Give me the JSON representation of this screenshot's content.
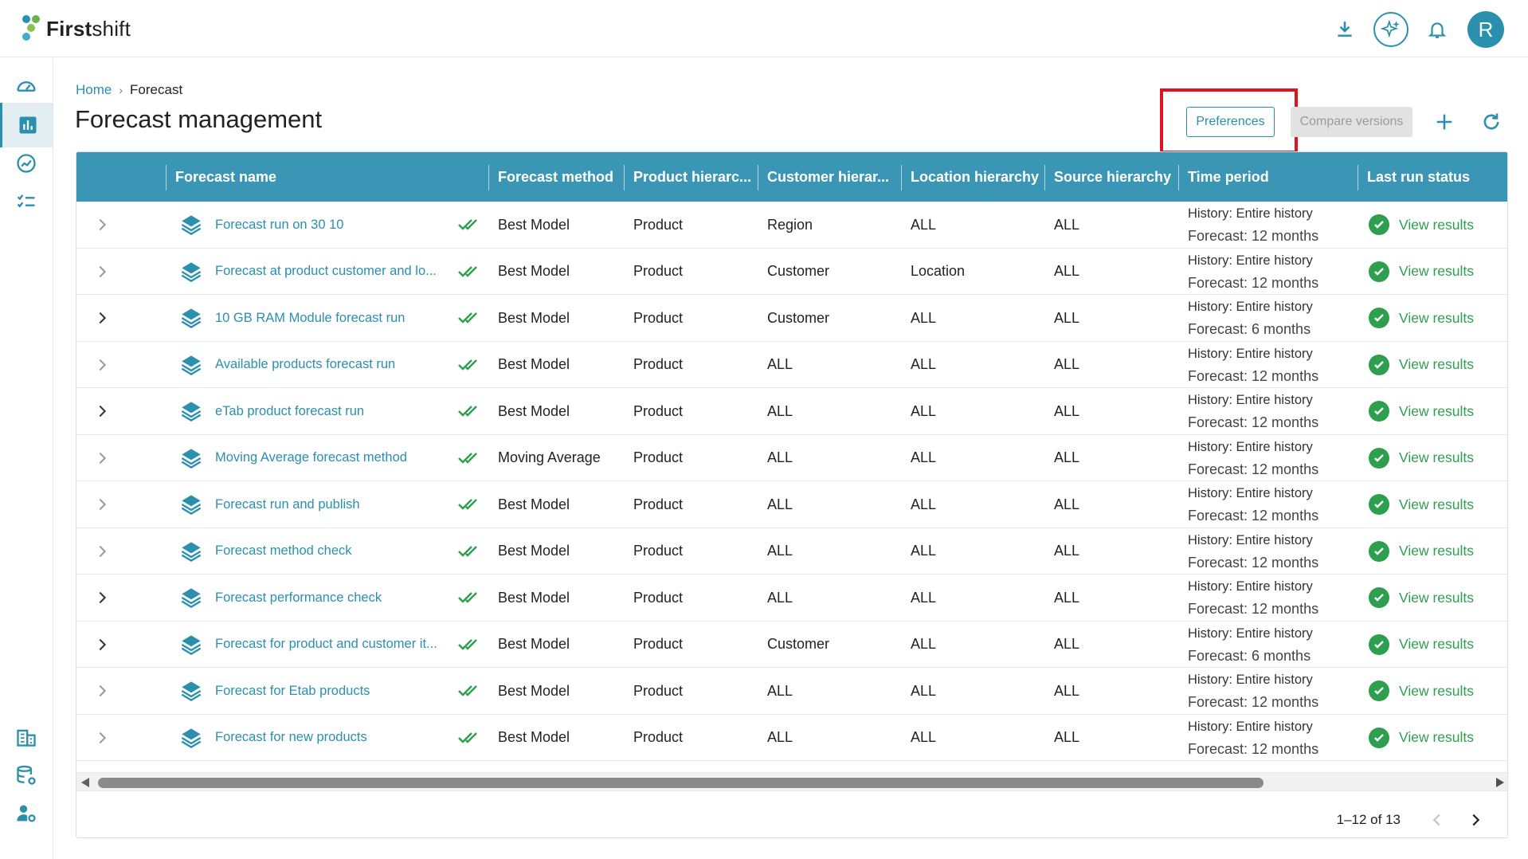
{
  "app": {
    "brand_bold": "First",
    "brand_light": "shift",
    "user_initial": "R"
  },
  "breadcrumb": {
    "home": "Home",
    "separator": "›",
    "current": "Forecast"
  },
  "page_title": "Forecast management",
  "actions": {
    "preferences_label": "Preferences",
    "compare_label": "Compare versions"
  },
  "table": {
    "columns": [
      "Forecast name",
      "Forecast method",
      "Product hierarc...",
      "Customer hierar...",
      "Location hierarchy",
      "Source hierarchy",
      "Time period",
      "Last run status"
    ],
    "rows": [
      {
        "name": "Forecast run on 30 10",
        "method": "Best Model",
        "product": "Product",
        "customer": "Region",
        "location": "ALL",
        "source": "ALL",
        "history": "History: Entire history",
        "forecast": "Forecast: 12 months",
        "status": "View results"
      },
      {
        "name": "Forecast at product customer and lo...",
        "method": "Best Model",
        "product": "Product",
        "customer": "Customer",
        "location": "Location",
        "source": "ALL",
        "history": "History: Entire history",
        "forecast": "Forecast: 12 months",
        "status": "View results"
      },
      {
        "name": "10 GB RAM Module forecast run",
        "method": "Best Model",
        "product": "Product",
        "customer": "Customer",
        "location": "ALL",
        "source": "ALL",
        "history": "History: Entire history",
        "forecast": "Forecast: 6 months",
        "status": "View results"
      },
      {
        "name": "Available products forecast run",
        "method": "Best Model",
        "product": "Product",
        "customer": "ALL",
        "location": "ALL",
        "source": "ALL",
        "history": "History: Entire history",
        "forecast": "Forecast: 12 months",
        "status": "View results"
      },
      {
        "name": "eTab product forecast run",
        "method": "Best Model",
        "product": "Product",
        "customer": "ALL",
        "location": "ALL",
        "source": "ALL",
        "history": "History: Entire history",
        "forecast": "Forecast: 12 months",
        "status": "View results"
      },
      {
        "name": "Moving Average forecast method",
        "method": "Moving Average",
        "product": "Product",
        "customer": "ALL",
        "location": "ALL",
        "source": "ALL",
        "history": "History: Entire history",
        "forecast": "Forecast: 12 months",
        "status": "View results"
      },
      {
        "name": "Forecast run and publish",
        "method": "Best Model",
        "product": "Product",
        "customer": "ALL",
        "location": "ALL",
        "source": "ALL",
        "history": "History: Entire history",
        "forecast": "Forecast: 12 months",
        "status": "View results"
      },
      {
        "name": "Forecast method check",
        "method": "Best Model",
        "product": "Product",
        "customer": "ALL",
        "location": "ALL",
        "source": "ALL",
        "history": "History: Entire history",
        "forecast": "Forecast: 12 months",
        "status": "View results"
      },
      {
        "name": "Forecast performance check",
        "method": "Best Model",
        "product": "Product",
        "customer": "ALL",
        "location": "ALL",
        "source": "ALL",
        "history": "History: Entire history",
        "forecast": "Forecast: 12 months",
        "status": "View results"
      },
      {
        "name": "Forecast for product and customer it...",
        "method": "Best Model",
        "product": "Product",
        "customer": "Customer",
        "location": "ALL",
        "source": "ALL",
        "history": "History: Entire history",
        "forecast": "Forecast: 6 months",
        "status": "View results"
      },
      {
        "name": "Forecast for Etab products",
        "method": "Best Model",
        "product": "Product",
        "customer": "ALL",
        "location": "ALL",
        "source": "ALL",
        "history": "History: Entire history",
        "forecast": "Forecast: 12 months",
        "status": "View results"
      },
      {
        "name": "Forecast for new products",
        "method": "Best Model",
        "product": "Product",
        "customer": "ALL",
        "location": "ALL",
        "source": "ALL",
        "history": "History: Entire history",
        "forecast": "Forecast: 12 months",
        "status": "View results"
      }
    ]
  },
  "pagination": {
    "range": "1–12 of 13"
  },
  "colors": {
    "accent": "#2b8fae",
    "header": "#3b96b6",
    "success": "#2e9e4f",
    "highlight": "#e0141e"
  }
}
